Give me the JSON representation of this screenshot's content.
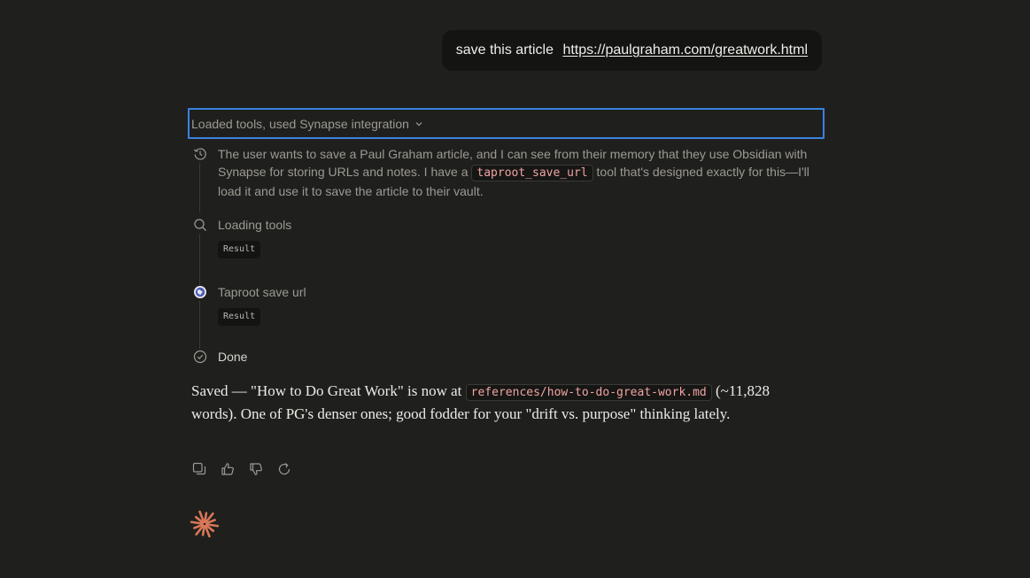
{
  "user_message": {
    "text": "save this article",
    "link": "https://paulgraham.com/greatwork.html"
  },
  "tools_header": {
    "label": "Loaded tools, used Synapse integration",
    "chevron_icon": "chevron-down-icon"
  },
  "thinking": {
    "icon": "clock-history-icon",
    "text_before": "The user wants to save a Paul Graham article, and I can see from their memory that they use Obsidian with Synapse for storing URLs and notes. I have a ",
    "code": "taproot_save_url",
    "text_after": " tool that's designed exactly for this—I'll load it and use it to save the article to their vault."
  },
  "steps": [
    {
      "icon": "search-icon",
      "label": "Loading tools",
      "result": "Result"
    },
    {
      "icon": "globe-icon",
      "label": "Taproot save url",
      "result": "Result"
    },
    {
      "icon": "check-circle-icon",
      "label": "Done"
    }
  ],
  "answer": {
    "text_before": "Saved — \"How to Do Great Work\" is now at ",
    "code": "references/how-to-do-great-work.md",
    "text_after": " (~11,828 words). One of PG's denser ones; good fodder for your \"drift vs. purpose\" thinking lately."
  },
  "actions": [
    "copy-icon",
    "thumbs-up-icon",
    "thumbs-down-icon",
    "retry-icon"
  ],
  "colors": {
    "background": "#1f1f1d",
    "accent_focus": "#3b82e0",
    "code_text": "#f0a4a0",
    "logo": "#d97757"
  }
}
